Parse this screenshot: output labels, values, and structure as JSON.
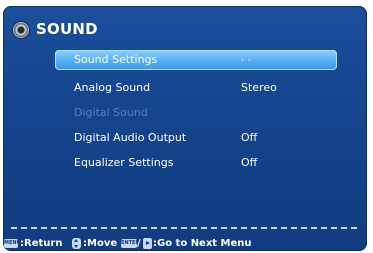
{
  "title": {
    "text": "SOUND",
    "icon": "speaker-icon"
  },
  "menu": {
    "items": [
      {
        "label": "Sound Settings",
        "value": "",
        "state": "selected",
        "arrow": "› ›"
      },
      {
        "label": "Analog Sound",
        "value": "Stereo",
        "state": "normal"
      },
      {
        "label": "Digital Sound",
        "value": "",
        "state": "disabled"
      },
      {
        "label": "Digital Audio Output",
        "value": "Off",
        "state": "normal"
      },
      {
        "label": "Equalizer Settings",
        "value": "Off",
        "state": "normal"
      }
    ]
  },
  "footer": {
    "menu_key": "MENU",
    "return_text": ":Return",
    "move_text": ":Move",
    "enter_key": "ENTER",
    "slash": "/",
    "go_text": ":Go to Next Menu"
  },
  "colors": {
    "panel": "#15458d",
    "highlight": "#54aef2",
    "disabled_text": "#5c7eb8",
    "text": "#ffffff"
  }
}
